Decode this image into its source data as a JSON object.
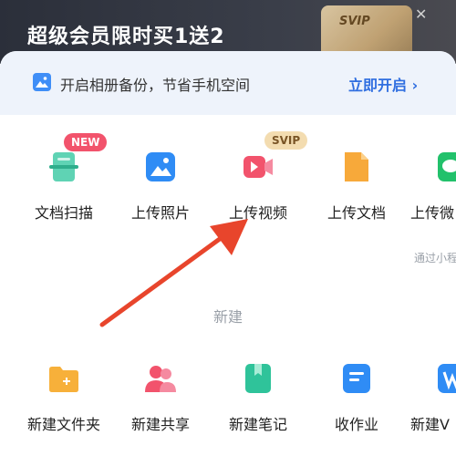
{
  "promo": {
    "title": "超级会员限时买1送2",
    "card_text": "SVIP"
  },
  "banner": {
    "text": "开启相册备份，节省手机空间",
    "link": "立即开启",
    "chevron": "›"
  },
  "upload_row": [
    {
      "label": "文档扫描",
      "icon": "scan-icon",
      "badge": "NEW"
    },
    {
      "label": "上传照片",
      "icon": "photo-icon"
    },
    {
      "label": "上传视频",
      "icon": "video-icon",
      "badge": "SVIP"
    },
    {
      "label": "上传文档",
      "icon": "document-icon"
    },
    {
      "label": "上传微",
      "icon": "wechat-icon"
    }
  ],
  "side_note": "通过小程",
  "section": {
    "title": "新建"
  },
  "create_row": [
    {
      "label": "新建文件夹",
      "icon": "folder-add-icon"
    },
    {
      "label": "新建共享",
      "icon": "share-people-icon"
    },
    {
      "label": "新建笔记",
      "icon": "note-icon"
    },
    {
      "label": "收作业",
      "icon": "homework-icon"
    },
    {
      "label": "新建V",
      "icon": "new-doc-icon"
    }
  ],
  "colors": {
    "accent": "#2f6ee0",
    "arrow": "#e8452c",
    "new_badge": "#f2536c",
    "svip_badge": "#f3dcb0"
  }
}
